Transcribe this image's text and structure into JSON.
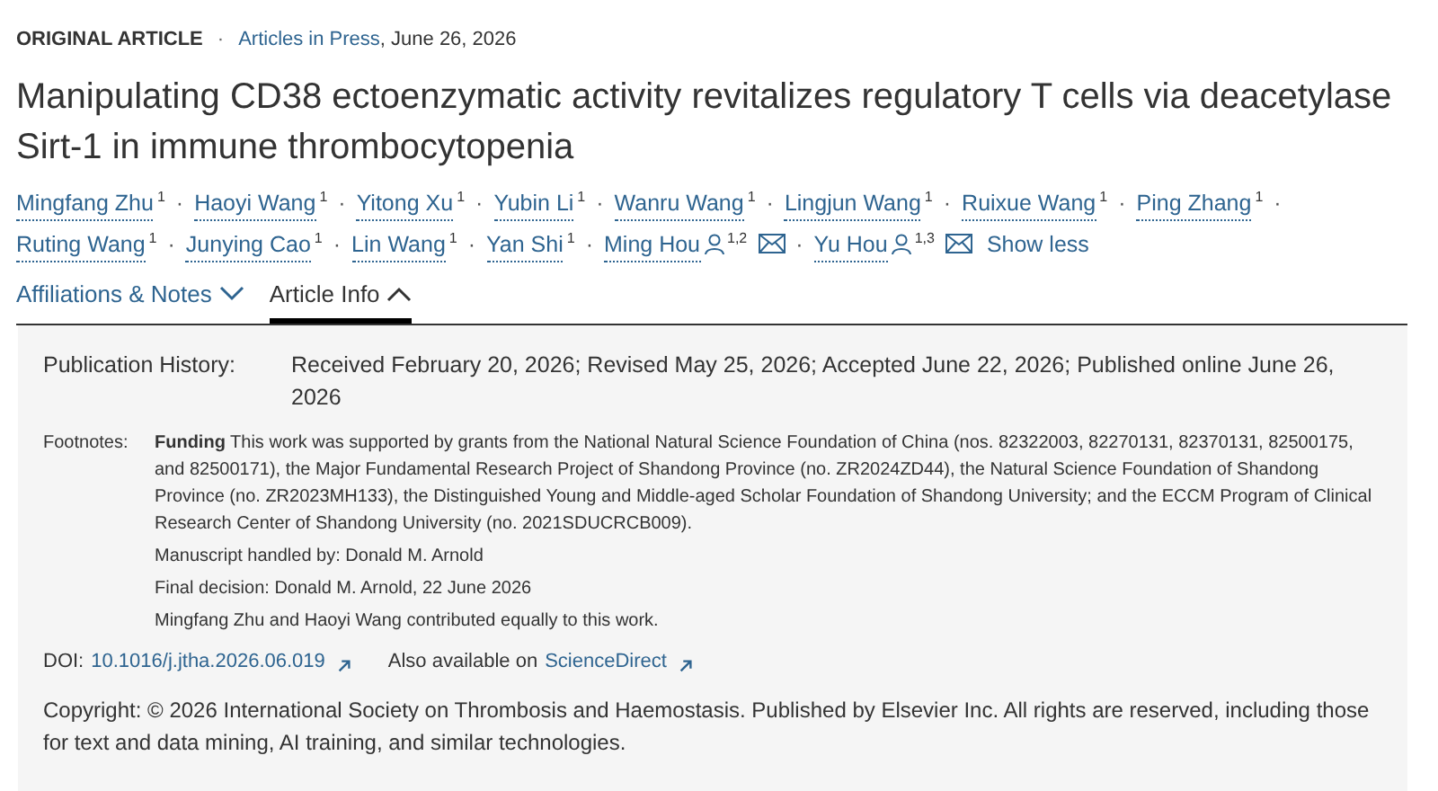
{
  "header": {
    "article_type": "ORIGINAL ARTICLE",
    "separator": "·",
    "issue_link": "Articles in Press",
    "date": ", June 26, 2026"
  },
  "title": "Manipulating CD38 ectoenzymatic activity revitalizes regulatory T cells via deacetylase Sirt-1 in immune thrombocytopenia",
  "author_lines": [
    [
      {
        "name": "Mingfang Zhu",
        "affil": "1",
        "corresponding": false,
        "email": false
      },
      {
        "name": "Haoyi Wang",
        "affil": "1",
        "corresponding": false,
        "email": false
      },
      {
        "name": "Yitong Xu",
        "affil": "1",
        "corresponding": false,
        "email": false
      },
      {
        "name": "Yubin Li",
        "affil": "1",
        "corresponding": false,
        "email": false
      },
      {
        "name": "Wanru Wang",
        "affil": "1",
        "corresponding": false,
        "email": false
      },
      {
        "name": "Lingjun Wang",
        "affil": "1",
        "corresponding": false,
        "email": false
      },
      {
        "name": "Ruixue Wang",
        "affil": "1",
        "corresponding": false,
        "email": false
      },
      {
        "name": "Ping Zhang",
        "affil": "1",
        "corresponding": false,
        "email": false
      }
    ],
    [
      {
        "name": "Ruting Wang",
        "affil": "1",
        "corresponding": false,
        "email": false
      },
      {
        "name": "Junying Cao",
        "affil": "1",
        "corresponding": false,
        "email": false
      },
      {
        "name": "Lin Wang",
        "affil": "1",
        "corresponding": false,
        "email": false
      },
      {
        "name": "Yan Shi",
        "affil": "1",
        "corresponding": false,
        "email": false
      },
      {
        "name": "Ming Hou",
        "affil": "1,2",
        "corresponding": true,
        "email": true
      },
      {
        "name": "Yu Hou",
        "affil": "1,3",
        "corresponding": true,
        "email": true
      }
    ]
  ],
  "author_separator": "·",
  "show_less": "Show less",
  "tabs": [
    {
      "label": "Affiliations & Notes",
      "selected": false,
      "expanded": false
    },
    {
      "label": "Article Info",
      "selected": true,
      "expanded": true
    }
  ],
  "info": {
    "history_label": "Publication History:",
    "history": "Received February 20, 2026; Revised May 25, 2026; Accepted June 22, 2026; Published online June 26, 2026",
    "footnotes_label": "Footnotes:",
    "footnotes": [
      "**Funding** This work was supported by grants from the National Natural Science Foundation of China (nos. 82322003, 82270131, 82370131, 82500175, and 82500171), the Major Fundamental Research Project of Shandong Province (no. ZR2024ZD44), the Natural Science Foundation of Shandong Province (no. ZR2023MH133), the Distinguished Young and Middle-aged Scholar Foundation of Shandong University; and the ECCM Program of Clinical Research Center of Shandong University (no. 2021SDUCRCB009).",
      "Manuscript handled by: Donald M. Arnold",
      "Final decision: Donald M. Arnold, 22 June 2026",
      "Mingfang Zhu and Haoyi Wang contributed equally to this work."
    ],
    "doi_label": "DOI:",
    "doi": "10.1016/j.jtha.2026.06.019",
    "also_label": "Also available on",
    "also_link": "ScienceDirect",
    "copyright": "Copyright: © 2026 International Society on Thrombosis and Haemostasis. Published by Elsevier Inc. All rights are reserved, including those for text and data mining, AI training, and similar technologies."
  }
}
